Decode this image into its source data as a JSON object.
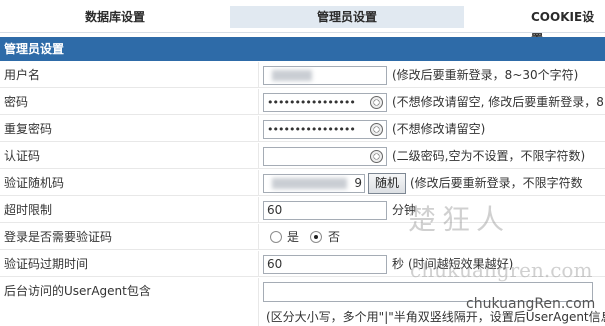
{
  "tabs": [
    {
      "label": "数据库设置",
      "active": false
    },
    {
      "label": "管理员设置",
      "active": true
    },
    {
      "label": "COOKIE设置",
      "active": false
    }
  ],
  "section_title": "管理员设置",
  "fields": {
    "username": {
      "label": "用户名",
      "hint": "(修改后要重新登录，8~30个字符)"
    },
    "password": {
      "label": "密码",
      "value": "••••••••••••••••",
      "hint": "(不想修改请留空, 修改后要重新登录，8"
    },
    "password_confirm": {
      "label": "重复密码",
      "value": "••••••••••••••••",
      "hint": "(不想修改请留空)"
    },
    "auth_code": {
      "label": "认证码",
      "value": "",
      "hint": "(二级密码,空为不设置，不限字符数)"
    },
    "verify_random": {
      "label": "验证随机码",
      "value_tail": "9",
      "button_label": "随机",
      "hint": "(修改后要重新登录，不限字符数"
    },
    "timeout": {
      "label": "超时限制",
      "value": "60",
      "unit": "分钟"
    },
    "login_captcha": {
      "label": "登录是否需要验证码",
      "options": [
        "是",
        "否"
      ],
      "selected": "否"
    },
    "captcha_expire": {
      "label": "验证码过期时间",
      "value": "60",
      "unit": "秒",
      "hint": "(时间越短效果越好)"
    },
    "useragent": {
      "label": "后台访问的UserAgent包含",
      "value": "",
      "hint": "(区分大小写，多个用\"|\"半角双竖线隔开，设置后UserAgent信息"
    }
  },
  "watermark": {
    "logo_text": "楚狂人",
    "url_faint": "chukuangren.com",
    "url": "chukuangRen.com"
  }
}
